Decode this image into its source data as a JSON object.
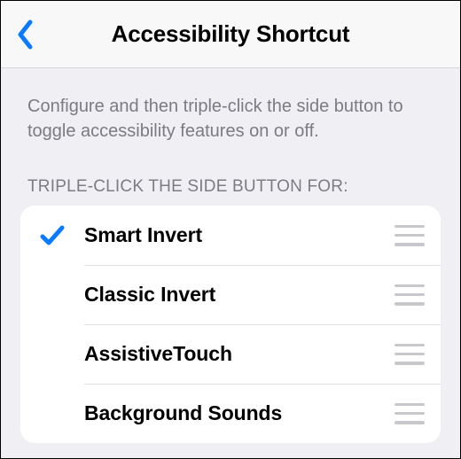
{
  "navbar": {
    "title": "Accessibility Shortcut"
  },
  "description": "Configure and then triple-click the side button to toggle accessibility features on or off.",
  "section_header": "TRIPLE-CLICK THE SIDE BUTTON FOR:",
  "items": [
    {
      "label": "Smart Invert",
      "checked": true
    },
    {
      "label": "Classic Invert",
      "checked": false
    },
    {
      "label": "AssistiveTouch",
      "checked": false
    },
    {
      "label": "Background Sounds",
      "checked": false
    }
  ],
  "colors": {
    "accent": "#0a7aff"
  }
}
